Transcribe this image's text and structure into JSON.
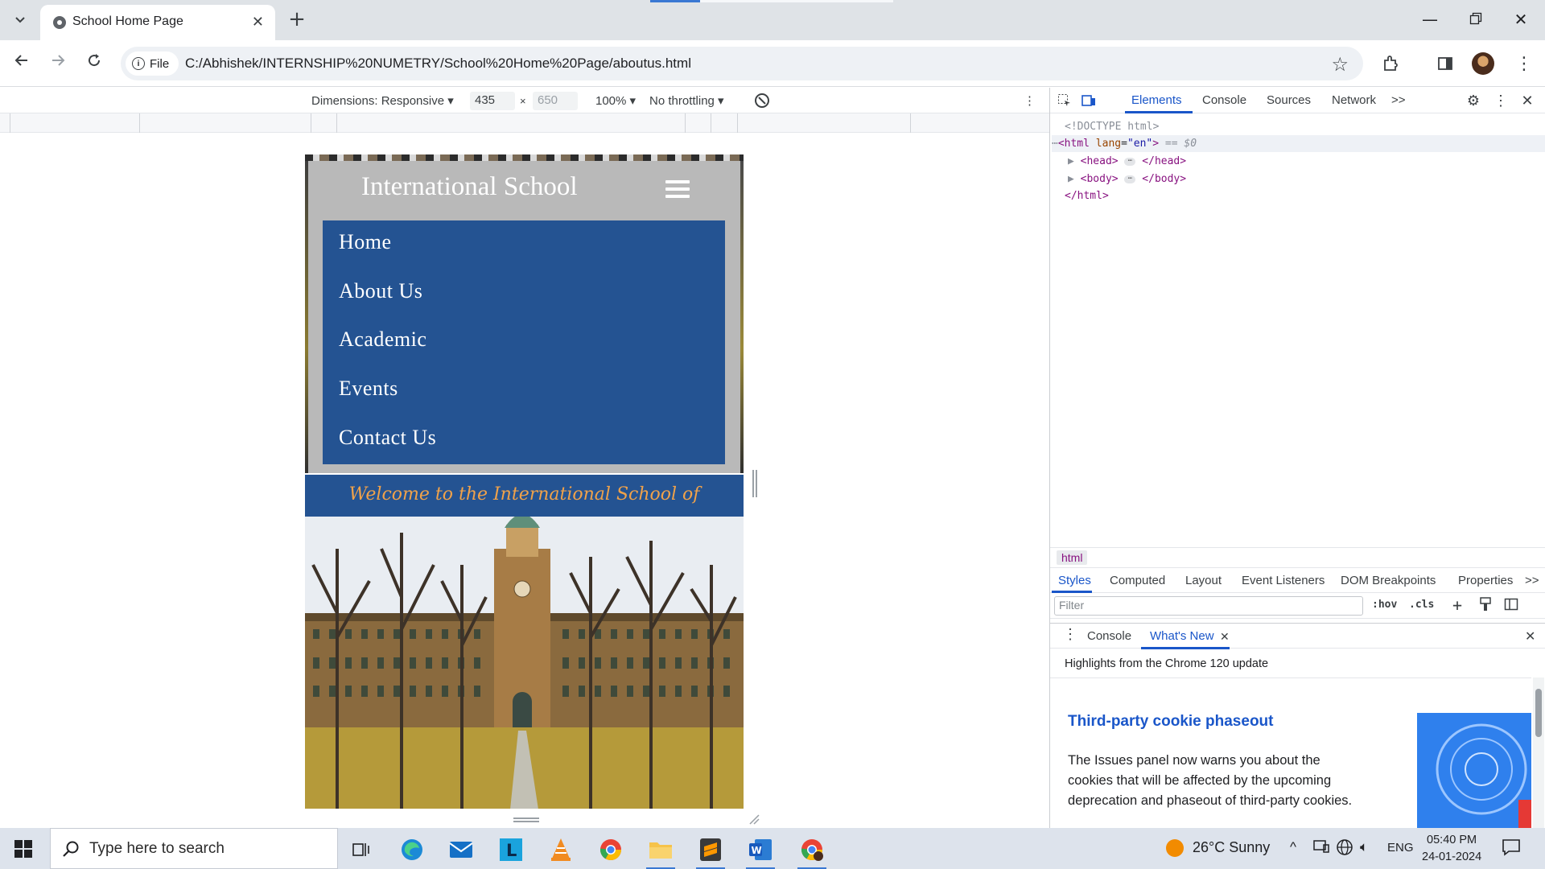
{
  "browser": {
    "tab_title": "School Home Page",
    "url_scheme_chip": "File",
    "url": "C:/Abhishek/INTERNSHIP%20NUMETRY/School%20Home%20Page/aboutus.html"
  },
  "device_toolbar": {
    "dimensions_label": "Dimensions: Responsive",
    "width": "435",
    "height": "650",
    "zoom": "100%",
    "throttling": "No throttling"
  },
  "site": {
    "title": "International School",
    "menu": [
      "Home",
      "About Us",
      "Academic",
      "Events",
      "Contact Us"
    ],
    "welcome": "Welcome to the International School of Maharastra"
  },
  "devtools": {
    "tabs": [
      "Elements",
      "Console",
      "Sources",
      "Network"
    ],
    "more_tabs": ">>",
    "dom": {
      "doctype": "<!DOCTYPE html>",
      "html_open_tag": "html",
      "lang_attr": "lang",
      "lang_value": "\"en\"",
      "selected_marker": "== $0",
      "head_tag": "head",
      "body_tag": "body",
      "html_close": "</html>"
    },
    "breadcrumb": "html",
    "styles_tabs": [
      "Styles",
      "Computed",
      "Layout",
      "Event Listeners",
      "DOM Breakpoints",
      "Properties"
    ],
    "filter_placeholder": "Filter",
    "hov": ":hov",
    "cls": ".cls",
    "drawer_tabs": [
      "Console",
      "What's New"
    ],
    "whats_new_heading": "Highlights from the Chrome 120 update",
    "feature_title": "Third-party cookie phaseout",
    "feature_body": "The Issues panel now warns you about the cookies that will be affected by the upcoming deprecation and phaseout of third-party cookies."
  },
  "taskbar": {
    "search_placeholder": "Type here to search",
    "weather": "26°C  Sunny",
    "language": "ENG",
    "time": "05:40 PM",
    "date": "24-01-2024"
  },
  "colors": {
    "menu_blue": "#245392",
    "header_gray": "#b9b9b9",
    "welcome_text": "#f0a24a",
    "devtools_accent": "#1a56c9"
  }
}
